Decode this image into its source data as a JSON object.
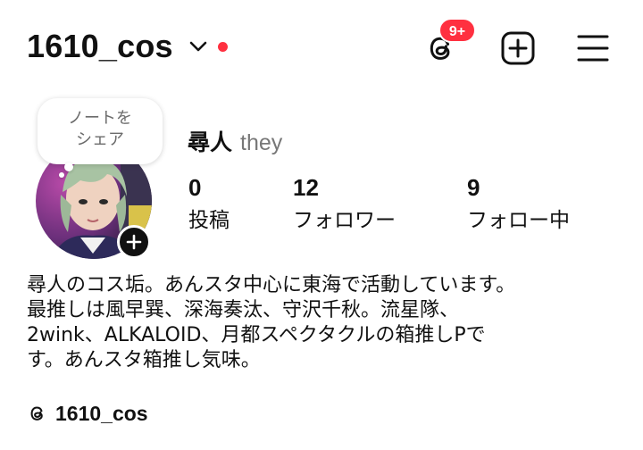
{
  "header": {
    "username": "1610_cos",
    "threads_badge": "9+",
    "icons": {
      "dropdown": "chevron-down-icon",
      "threads": "threads-icon",
      "create": "plus-square-icon",
      "menu": "hamburger-menu-icon"
    },
    "accent_color": "#ff3040"
  },
  "profile": {
    "note_line1": "ノートを",
    "note_line2": "シェア",
    "display_name": "尋人",
    "pronouns": "they",
    "stats": [
      {
        "value": "0",
        "label": "投稿"
      },
      {
        "value": "12",
        "label": "フォロワー"
      },
      {
        "value": "9",
        "label": "フォロー中"
      }
    ]
  },
  "bio": {
    "lines": [
      "尋人のコス垢。あんスタ中心に東海で活動しています。",
      "最推しは風早巽、深海奏汰、守沢千秋。流星隊、",
      "2wink、ALKALOID、月都スペクタクルの箱推しPで",
      "す。あんスタ箱推し気味。"
    ]
  },
  "threads_link": {
    "handle": "1610_cos",
    "icon": "threads-icon"
  }
}
